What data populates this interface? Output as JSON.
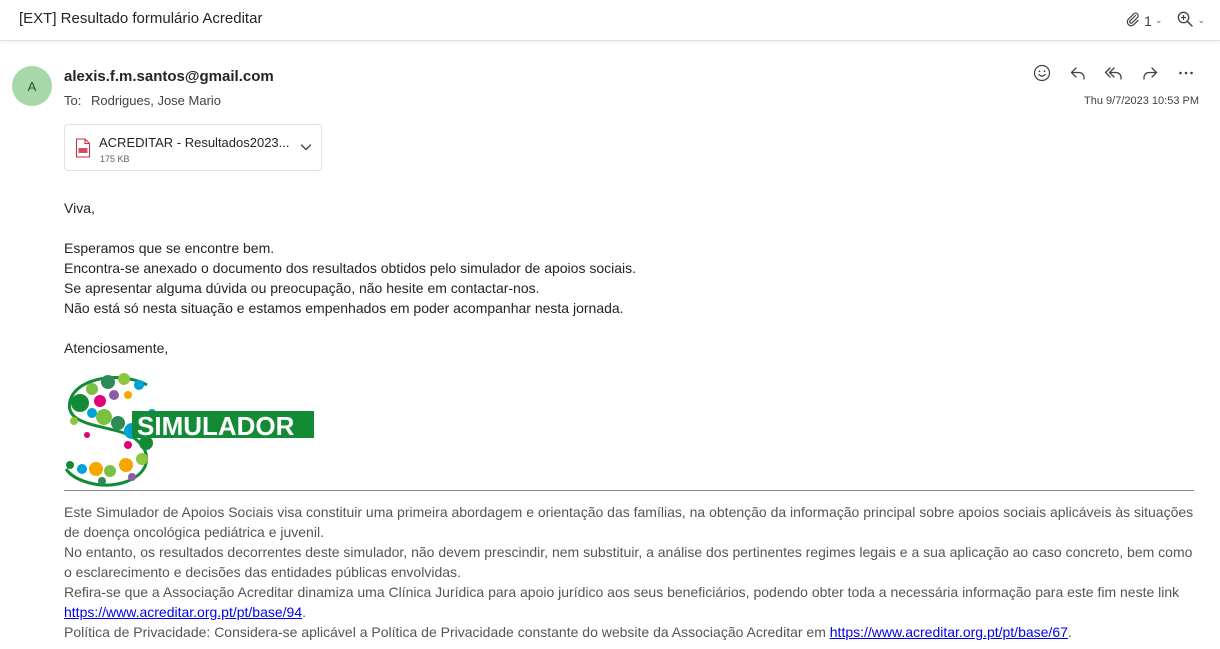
{
  "header": {
    "subject": "[EXT] Resultado formulário Acreditar",
    "attachment_count": "1"
  },
  "message": {
    "avatar_initial": "A",
    "from": "alexis.f.m.santos@gmail.com",
    "to_label": "To:",
    "to": "Rodrigues, Jose Mario",
    "datetime": "Thu 9/7/2023 10:53 PM"
  },
  "attachment": {
    "name": "ACREDITAR - Resultados2023...",
    "size": "175 KB",
    "icon": "pdf-file-icon"
  },
  "body": {
    "greeting": "Viva,",
    "line1": "Esperamos que se encontre bem.",
    "line2": "Encontra-se anexado o documento dos resultados obtidos pelo simulador de apoios sociais.",
    "line3": "Se apresentar alguma dúvida ou preocupação, não hesite em contactar-nos.",
    "line4": "Não está só nesta situação e estamos empenhados em poder acompanhar nesta jornada.",
    "closing": "Atenciosamente,"
  },
  "logo": {
    "text": "SIMULADOR",
    "brand_color": "#138a36"
  },
  "disclaimer": {
    "p1": "Este Simulador de Apoios Sociais visa constituir uma primeira abordagem e orientação das famílias, na obtenção da informação principal sobre apoios sociais aplicáveis às situações de doença oncológica pediátrica e juvenil.",
    "p2": "No entanto, os resultados decorrentes deste simulador, não devem prescindir, nem substituir, a análise dos pertinentes regimes legais e a sua aplicação ao caso concreto, bem como o esclarecimento e decisões das entidades públicas envolvidas.",
    "p3_text": "Refira-se que a Associação Acreditar dinamiza uma Clínica Jurídica para apoio jurídico aos seus beneficiários, podendo obter toda a necessária informação para este fim neste link ",
    "p3_link": "https://www.acreditar.org.pt/pt/base/94",
    "p3_end": ".",
    "p4_text": "Política de Privacidade: Considera-se aplicável a Política de Privacidade constante do website da Associação Acreditar em ",
    "p4_link": "https://www.acreditar.org.pt/pt/base/67",
    "p4_end": "."
  },
  "colors": {
    "avatar_bg": "#a7d8a8",
    "link": "#0000ee"
  }
}
